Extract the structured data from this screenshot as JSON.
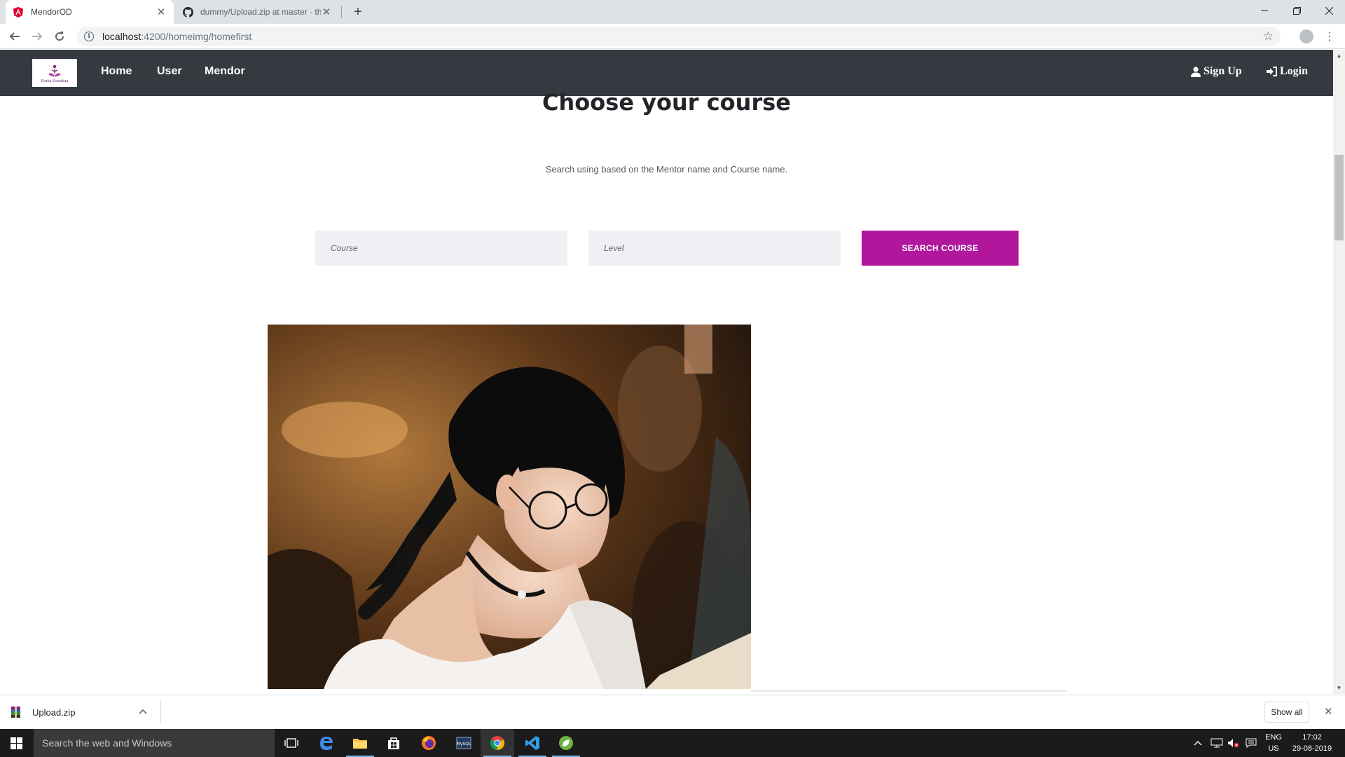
{
  "browser": {
    "tabs": [
      {
        "title": "MendorOD",
        "favicon": "angular-icon",
        "active": true
      },
      {
        "title": "dummy/Upload.zip at master · th",
        "favicon": "github-icon",
        "active": false
      }
    ],
    "new_tab_symbol": "+",
    "window_controls": {
      "minimize": "—",
      "restore": "❐",
      "close": "✕"
    },
    "address": {
      "host": "localhost",
      "path": ":4200/homeimg/homefirst"
    },
    "nav": {
      "back": "←",
      "forward": "→",
      "reload": "↻"
    },
    "bookmark_icon": "☆",
    "menu_icon": "⋮"
  },
  "site": {
    "logo_text": "Karka Kasadara",
    "nav_links": [
      "Home",
      "User",
      "Mendor"
    ],
    "sign_up": "Sign Up",
    "login": "Login"
  },
  "main": {
    "title": "Choose your course",
    "subtitle": "Search using based on the Mentor name and Course name.",
    "course_placeholder": "Course",
    "level_placeholder": "Level",
    "search_button": "SEARCH COURSE",
    "accent_color": "#b0179d"
  },
  "download_bar": {
    "file_name": "Upload.zip",
    "show_all": "Show all",
    "close": "✕",
    "chevron": "^"
  },
  "taskbar": {
    "search_placeholder": "Search the web and Windows",
    "language_top": "ENG",
    "language_bottom": "US",
    "time": "17:02",
    "date": "29-08-2019"
  }
}
